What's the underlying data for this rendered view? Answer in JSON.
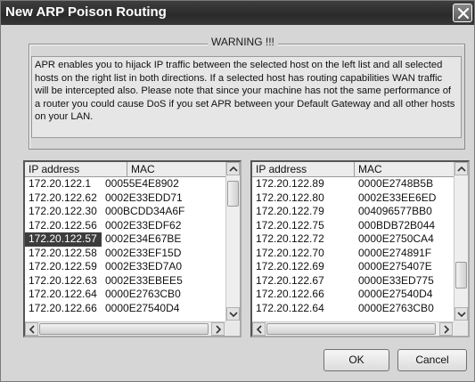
{
  "window": {
    "title": "New ARP Poison Routing"
  },
  "warning": {
    "legend": "WARNING !!!",
    "text": "APR enables you to hijack IP traffic between the selected host on the left list and all selected hosts on the right list in both directions. If a selected host has routing capabilities WAN traffic will be intercepted also. Please note that since your machine has not the same performance of a router you could cause DoS if you set APR between your Default Gateway and all other hosts on your LAN."
  },
  "left_list": {
    "columns": [
      "IP address",
      "MAC"
    ],
    "rows": [
      {
        "ip": "172.20.122.1",
        "mac": "00055E4E8902"
      },
      {
        "ip": "172.20.122.62",
        "mac": "0002E33EDD71"
      },
      {
        "ip": "172.20.122.30",
        "mac": "000BCDD34A6F"
      },
      {
        "ip": "172.20.122.56",
        "mac": "0002E33EDF62"
      },
      {
        "ip": "172.20.122.57",
        "mac": "0002E34E67BE"
      },
      {
        "ip": "172.20.122.58",
        "mac": "0002E33EF15D"
      },
      {
        "ip": "172.20.122.59",
        "mac": "0002E33ED7A0"
      },
      {
        "ip": "172.20.122.63",
        "mac": "0002E33EBEE5"
      },
      {
        "ip": "172.20.122.64",
        "mac": "0000E2763CB0"
      },
      {
        "ip": "172.20.122.66",
        "mac": "0000E27540D4"
      }
    ],
    "selected_index": 4
  },
  "right_list": {
    "columns": [
      "IP address",
      "MAC"
    ],
    "rows": [
      {
        "ip": "172.20.122.89",
        "mac": "0000E2748B5B"
      },
      {
        "ip": "172.20.122.80",
        "mac": "0002E33EE6ED"
      },
      {
        "ip": "172.20.122.79",
        "mac": "004096577BB0"
      },
      {
        "ip": "172.20.122.75",
        "mac": "000BDB72B044"
      },
      {
        "ip": "172.20.122.72",
        "mac": "0000E2750CA4"
      },
      {
        "ip": "172.20.122.70",
        "mac": "0000E274891F"
      },
      {
        "ip": "172.20.122.69",
        "mac": "0000E275407E"
      },
      {
        "ip": "172.20.122.67",
        "mac": "0000E33ED775"
      },
      {
        "ip": "172.20.122.66",
        "mac": "0000E27540D4"
      },
      {
        "ip": "172.20.122.64",
        "mac": "0000E2763CB0"
      }
    ]
  },
  "buttons": {
    "ok": "OK",
    "cancel": "Cancel"
  },
  "icons": {
    "close": "close-icon",
    "scroll_up": "chevron-up-icon",
    "scroll_down": "chevron-down-icon",
    "scroll_left": "chevron-left-icon",
    "scroll_right": "chevron-right-icon"
  },
  "colors": {
    "titlebar": "#2f2f2f",
    "dialog_bg": "#d6d6d6",
    "selection": "#3c3c3c"
  }
}
